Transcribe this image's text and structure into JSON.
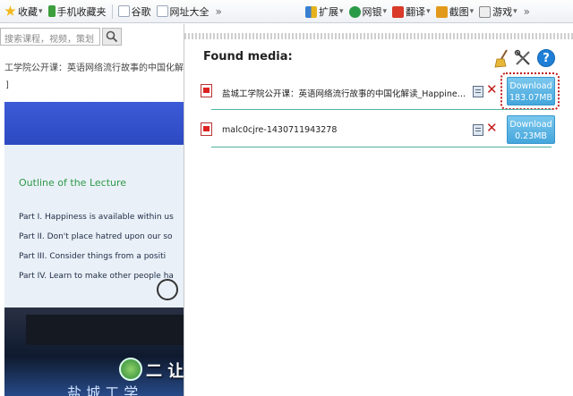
{
  "toolbar": {
    "left_items": [
      {
        "label": "收藏",
        "icon": "star-icon",
        "color": "#f2b81d"
      },
      {
        "label": "手机收藏夹",
        "icon": "phone-icon",
        "color": "#3d9e3d"
      },
      {
        "label": "谷歌",
        "icon": "google-page-icon",
        "color": "#9aa7b8"
      },
      {
        "label": "网址大全",
        "icon": "web-directory-icon",
        "color": "#9aa7b8"
      }
    ],
    "more": "»",
    "right_items": [
      {
        "label": "扩展",
        "icon": "extension-icon",
        "color": "#3a7fd0"
      },
      {
        "label": "网银",
        "icon": "bank-icon",
        "color": "#2b9a47"
      },
      {
        "label": "翻译",
        "icon": "translate-icon",
        "color": "#d93a2a"
      },
      {
        "label": "截图",
        "icon": "screenshot-icon",
        "color": "#e39a1c"
      },
      {
        "label": "游戏",
        "icon": "game-icon",
        "color": "#888888"
      }
    ]
  },
  "left_page": {
    "search_placeholder": "搜索课程，视频，策划",
    "lesson_title": "工学院公开课：英语网络流行故事的中国化解读",
    "bracket": "]",
    "slide": {
      "title": "Outline of the Lecture",
      "lines": [
        "Part I.  Happiness is available within us",
        "Part II.  Don't place hatred upon our so",
        "Part III.  Consider things from a positi",
        "Part IV.  Learn to make other people ha"
      ]
    },
    "subtitle": "二 让",
    "subtitle_bottom": "盐 城 工 学"
  },
  "panel": {
    "heading": "Found media:",
    "media": [
      {
        "name": "盐城工学院公开课：英语网络流行故事的中国化解读_Happiness is available within us",
        "download_label": "Download",
        "size": "183.07MB"
      },
      {
        "name": "malc0cjre-1430711943278",
        "download_label": "Download",
        "size": "0.23MB"
      }
    ],
    "colors": {
      "accent": "#44a6dc",
      "divider": "#4cb4a0",
      "highlight": "#c01a1a"
    }
  }
}
